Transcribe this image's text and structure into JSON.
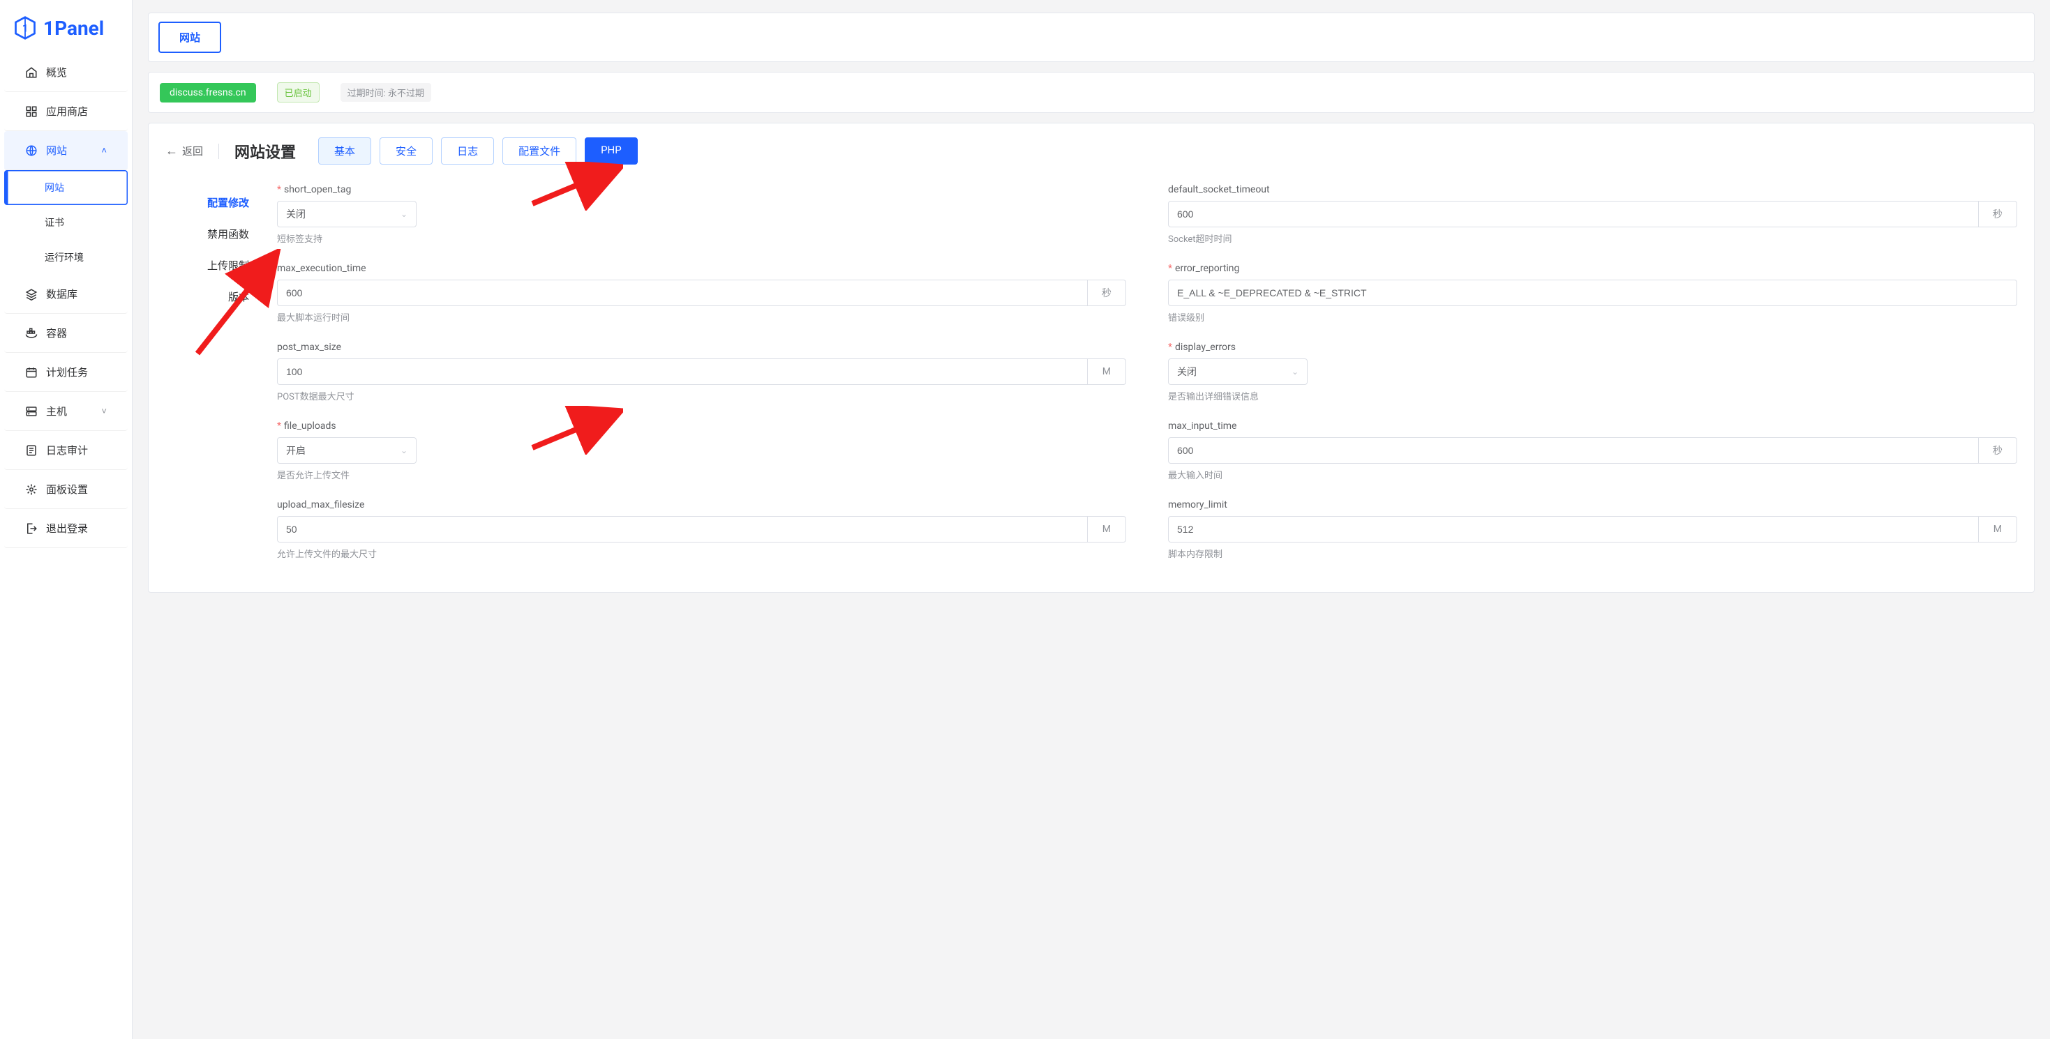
{
  "brand": "1Panel",
  "sidebar": {
    "items": [
      {
        "label": "概览",
        "icon": "home"
      },
      {
        "label": "应用商店",
        "icon": "apps"
      },
      {
        "label": "网站",
        "icon": "globe",
        "expanded": true,
        "children": [
          {
            "label": "网站",
            "active": true
          },
          {
            "label": "证书"
          },
          {
            "label": "运行环境"
          }
        ]
      },
      {
        "label": "数据库",
        "icon": "layers"
      },
      {
        "label": "容器",
        "icon": "container"
      },
      {
        "label": "计划任务",
        "icon": "calendar"
      },
      {
        "label": "主机",
        "icon": "server",
        "caret": true
      },
      {
        "label": "日志审计",
        "icon": "log"
      },
      {
        "label": "面板设置",
        "icon": "gear"
      },
      {
        "label": "退出登录",
        "icon": "logout"
      }
    ]
  },
  "top_tabs": {
    "active": "网站"
  },
  "site_info": {
    "domain": "discuss.fresns.cn",
    "status": "已启动",
    "expire": "过期时间: 永不过期"
  },
  "settings": {
    "back_label": "返回",
    "title": "网站设置",
    "tabs": [
      {
        "label": "基本",
        "style": "light"
      },
      {
        "label": "安全",
        "style": "outline"
      },
      {
        "label": "日志",
        "style": "outline"
      },
      {
        "label": "配置文件",
        "style": "outline"
      },
      {
        "label": "PHP",
        "style": "solid"
      }
    ],
    "left_menu": [
      {
        "label": "配置修改",
        "active": true
      },
      {
        "label": "禁用函数"
      },
      {
        "label": "上传限制"
      },
      {
        "label": "版本"
      }
    ]
  },
  "form": {
    "left": [
      {
        "key": "short_open_tag",
        "label": "short_open_tag",
        "required": true,
        "type": "select",
        "value": "关闭",
        "hint": "短标签支持"
      },
      {
        "key": "max_execution_time",
        "label": "max_execution_time",
        "required": false,
        "type": "input",
        "value": "600",
        "suffix": "秒",
        "hint": "最大脚本运行时间"
      },
      {
        "key": "post_max_size",
        "label": "post_max_size",
        "required": false,
        "type": "input",
        "value": "100",
        "suffix": "M",
        "hint": "POST数据最大尺寸"
      },
      {
        "key": "file_uploads",
        "label": "file_uploads",
        "required": true,
        "type": "select",
        "value": "开启",
        "hint": "是否允许上传文件"
      },
      {
        "key": "upload_max_filesize",
        "label": "upload_max_filesize",
        "required": false,
        "type": "input",
        "value": "50",
        "suffix": "M",
        "hint": "允许上传文件的最大尺寸"
      }
    ],
    "right": [
      {
        "key": "default_socket_timeout",
        "label": "default_socket_timeout",
        "required": false,
        "type": "input",
        "value": "600",
        "suffix": "秒",
        "hint": "Socket超时时间"
      },
      {
        "key": "error_reporting",
        "label": "error_reporting",
        "required": true,
        "type": "input",
        "value": "E_ALL & ~E_DEPRECATED & ~E_STRICT",
        "hint": "错误级别"
      },
      {
        "key": "display_errors",
        "label": "display_errors",
        "required": true,
        "type": "select",
        "value": "关闭",
        "hint": "是否输出详细错误信息"
      },
      {
        "key": "max_input_time",
        "label": "max_input_time",
        "required": false,
        "type": "input",
        "value": "600",
        "suffix": "秒",
        "hint": "最大输入时间"
      },
      {
        "key": "memory_limit",
        "label": "memory_limit",
        "required": false,
        "type": "input",
        "value": "512",
        "suffix": "M",
        "hint": "脚本内存限制"
      }
    ]
  }
}
